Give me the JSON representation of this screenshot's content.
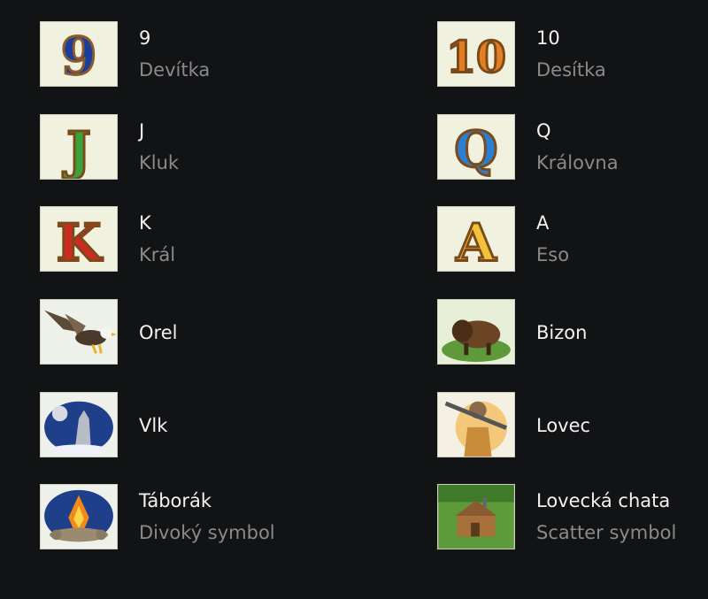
{
  "symbols": [
    {
      "name": "9",
      "desc": "Devítka",
      "icon": "nine-card-icon"
    },
    {
      "name": "10",
      "desc": "Desítka",
      "icon": "ten-card-icon"
    },
    {
      "name": "J",
      "desc": "Kluk",
      "icon": "jack-card-icon"
    },
    {
      "name": "Q",
      "desc": "Královna",
      "icon": "queen-card-icon"
    },
    {
      "name": "K",
      "desc": "Král",
      "icon": "king-card-icon"
    },
    {
      "name": "A",
      "desc": "Eso",
      "icon": "ace-card-icon"
    },
    {
      "name": "Orel",
      "icon": "eagle-icon"
    },
    {
      "name": "Bizon",
      "icon": "bison-icon"
    },
    {
      "name": "Vlk",
      "icon": "wolf-icon"
    },
    {
      "name": "Lovec",
      "icon": "hunter-icon"
    },
    {
      "name": "Táborák",
      "desc": "Divoký symbol",
      "icon": "campfire-icon"
    },
    {
      "name": "Lovecká chata",
      "desc": "Scatter symbol",
      "icon": "hunting-cabin-icon"
    }
  ],
  "colors": {
    "background": "#121315",
    "title": "#f2f2f2",
    "subtitle": "#8a8a8a",
    "tile": "#f1f1df"
  }
}
